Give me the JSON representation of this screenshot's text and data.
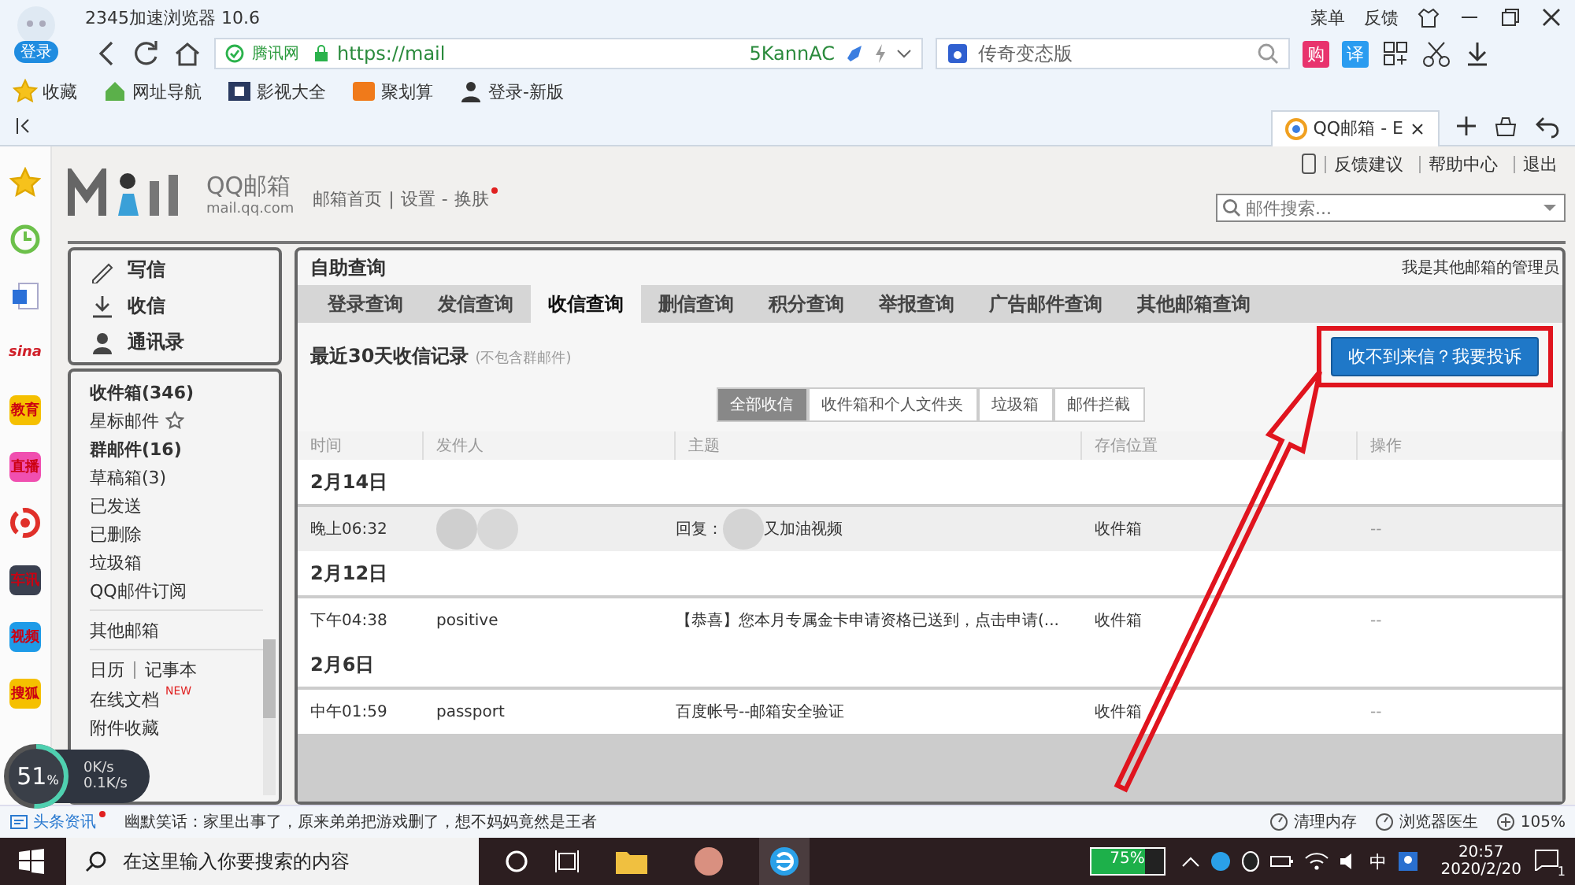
{
  "browser": {
    "avatar_label": "登录",
    "title": "2345加速浏览器 10.6",
    "menu": [
      "菜单",
      "反馈"
    ],
    "address": {
      "site_label": "腾讯网",
      "url_start": "https://mail",
      "url_end": "5KannAC"
    },
    "search": {
      "value": "传奇变态版"
    },
    "toolbar_badges": [
      {
        "label": "购",
        "color": "#e8336d"
      },
      {
        "label": "译",
        "color": "#2b9cf0"
      }
    ],
    "bookmarks": [
      {
        "label": "收藏",
        "kind": "star"
      },
      {
        "label": "网址导航",
        "kind": "home"
      },
      {
        "label": "影视大全",
        "kind": "film"
      },
      {
        "label": "聚划算",
        "kind": "deal"
      },
      {
        "label": "登录-新版",
        "kind": "user"
      }
    ],
    "tabs": [
      {
        "label": "QQ邮箱 - E",
        "selected": true
      }
    ],
    "side_icons": [
      {
        "kind": "star"
      },
      {
        "kind": "clock"
      },
      {
        "kind": "doc"
      },
      {
        "kind": "text",
        "label": "sina",
        "color": "#d0202a"
      },
      {
        "kind": "badge",
        "label": "教育",
        "color": "#f5c000"
      },
      {
        "kind": "badge",
        "label": "直播",
        "color": "#f04fb0"
      },
      {
        "kind": "swirl"
      },
      {
        "kind": "badge",
        "label": "车讯",
        "color": "#3a4050"
      },
      {
        "kind": "badge",
        "label": "视频",
        "color": "#1e9be8"
      },
      {
        "kind": "badge",
        "label": "搜狐",
        "color": "#f5c000"
      }
    ]
  },
  "mail": {
    "logo": {
      "name": "QQ邮箱",
      "domain": "mail.qq.com"
    },
    "nav": [
      {
        "label": "邮箱首页",
        "sep": "|",
        "notice": false
      },
      {
        "label": "设置",
        "sep": "-",
        "notice": false
      },
      {
        "label": "换肤",
        "notice": true
      }
    ],
    "top_links": [
      "反馈建议",
      "帮助中心",
      "退出"
    ],
    "search": {
      "placeholder": "邮件搜索..."
    },
    "actions": [
      {
        "kind": "compose",
        "label": "写信"
      },
      {
        "kind": "receive",
        "label": "收信"
      },
      {
        "kind": "contacts",
        "label": "通讯录"
      }
    ],
    "folders": [
      {
        "label": "收件箱(346)",
        "unread": true,
        "starred": false
      },
      {
        "label": "星标邮件",
        "unread": false,
        "starred": true
      },
      {
        "label": "群邮件(16)",
        "unread": true,
        "starred": false
      },
      {
        "label": "草稿箱(3)",
        "unread": false,
        "starred": false
      },
      {
        "label": "已发送",
        "unread": false,
        "starred": false
      },
      {
        "label": "已删除",
        "unread": false,
        "starred": false
      },
      {
        "label": "垃圾箱",
        "unread": false,
        "starred": false
      },
      {
        "label": "QQ邮件订阅",
        "unread": false,
        "starred": false
      }
    ],
    "other_mailbox": "其他邮箱",
    "tools": [
      "日历",
      "记事本"
    ],
    "apps": [
      {
        "label": "在线文档",
        "badge": "NEW"
      },
      {
        "label": "附件收藏"
      }
    ],
    "page_title": "自助查询",
    "admin_link": "我是其他邮箱的管理员",
    "tabs": [
      {
        "label": "登录查询",
        "selected": false
      },
      {
        "label": "发信查询",
        "selected": false
      },
      {
        "label": "收信查询",
        "selected": true
      },
      {
        "label": "删信查询",
        "selected": false
      },
      {
        "label": "积分查询",
        "selected": false
      },
      {
        "label": "举报查询",
        "selected": false
      },
      {
        "label": "广告邮件查询",
        "selected": false
      },
      {
        "label": "其他邮箱查询",
        "selected": false
      }
    ],
    "heading": "最近30天收信记录",
    "heading_note": "(不包含群邮件)",
    "complain_button": {
      "label": "收不到来信？我要投诉",
      "highlighted": true
    },
    "filters": [
      {
        "label": "全部收信",
        "selected": true
      },
      {
        "label": "收件箱和个人文件夹",
        "selected": false
      },
      {
        "label": "垃圾箱",
        "selected": false
      },
      {
        "label": "邮件拦截",
        "selected": false
      }
    ],
    "columns": [
      "时间",
      "发件人",
      "主题",
      "存信位置",
      "操作"
    ],
    "rows": [
      {
        "kind": "date",
        "text": "2月14日"
      },
      {
        "kind": "mail",
        "selected": true,
        "time": "晚上06:32",
        "subject_parts": [
          "回复：",
          "又加油视频"
        ],
        "folder": "收件箱",
        "action": "--"
      },
      {
        "kind": "date",
        "text": "2月12日"
      },
      {
        "kind": "mail",
        "selected": false,
        "time": "下午04:38",
        "sender": "positive",
        "subject_parts": [
          "【恭喜】您本月专属金卡申请资格已送到，点击申请(..."
        ],
        "folder": "收件箱",
        "action": "--"
      },
      {
        "kind": "date",
        "text": "2月6日"
      },
      {
        "kind": "mail",
        "selected": false,
        "time": "中午01:59",
        "sender": "passport",
        "subject_parts": [
          "百度帐号--邮箱安全验证"
        ],
        "folder": "收件箱",
        "action": "--"
      }
    ]
  },
  "speed": {
    "level": 0.51,
    "percent": "51",
    "unit": "%",
    "up": "0K/s",
    "down": "0.1K/s"
  },
  "status_bar": {
    "news_label": "头条资讯",
    "news_text": "幽默笑话：家里出事了，原来弟弟把游戏删了，想不妈妈竟然是王者",
    "tools": [
      "清理内存",
      "浏览器医生"
    ],
    "zoom": "105%"
  },
  "taskbar": {
    "search_placeholder": "在这里输入你要搜索的内容",
    "battery": {
      "label": "75%",
      "level": 0.75
    },
    "ime": "中",
    "time": "20:57",
    "date": "2020/2/20",
    "notifications": "1"
  },
  "annotations": [
    {
      "kind": "arrow"
    }
  ]
}
